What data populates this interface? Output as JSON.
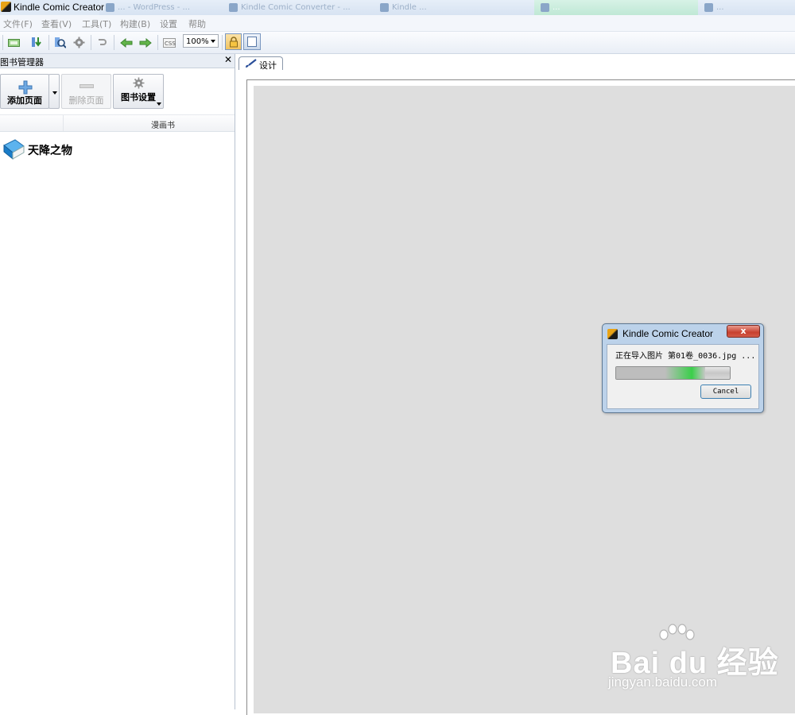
{
  "window": {
    "title": "Kindle Comic Creator",
    "background_tabs": [
      "... - WordPress - ...",
      "Kindle Comic Converter - ...",
      "Kindle ...",
      "...",
      "..."
    ]
  },
  "menu": [
    "文件(F)",
    "查看(V)",
    "工具(T)",
    "构建(B)",
    "设置",
    "帮助"
  ],
  "toolbar": {
    "zoom": "100%"
  },
  "book_manager": {
    "title": "图书管理器",
    "close": "✕",
    "add_page": "添加页面",
    "delete_page": "删除页面",
    "book_settings": "图书设置",
    "column_header": "漫画书",
    "book_name": "天降之物"
  },
  "design": {
    "tab_label": "设计"
  },
  "dialog": {
    "title": "Kindle Comic Creator",
    "close": "x",
    "message_cn": "正在导入图片",
    "message_file": "第01卷_0036.jpg ...",
    "progress": 0.78,
    "cancel": "Cancel"
  },
  "watermark": {
    "logo": "Bai du 经验",
    "url": "jingyan.baidu.com"
  },
  "colors": {
    "canvas": "#dedede",
    "progress_green": "#3acf4a",
    "close_red": "#c7402f"
  }
}
